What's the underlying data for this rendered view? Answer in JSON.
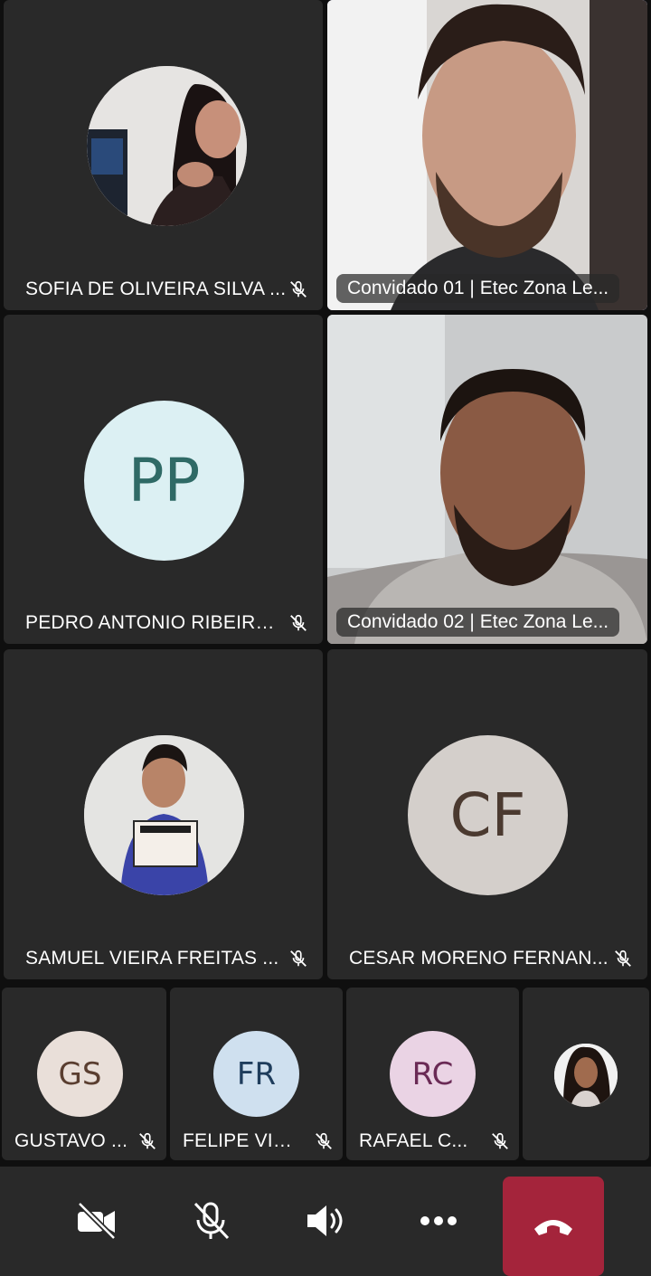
{
  "participants": {
    "p1": {
      "name": "SOFIA DE OLIVEIRA SILVA ...",
      "muted": true,
      "avatar_type": "photo"
    },
    "p2": {
      "name": "Convidado 01 | Etec Zona Le...",
      "active_speaker": true,
      "video": true
    },
    "p3": {
      "name": "PEDRO ANTONIO RIBEIRO ...",
      "initials": "PP",
      "muted": true,
      "avatar_bg": "#dcf0f3",
      "avatar_fg": "#2f6a66"
    },
    "p4": {
      "name": "Convidado 02 | Etec Zona Le...",
      "video": true
    },
    "p5": {
      "name": "SAMUEL VIEIRA FREITAS ...",
      "muted": true,
      "avatar_type": "photo"
    },
    "p6": {
      "name": "CESAR MORENO FERNAN...",
      "initials": "CF",
      "muted": true,
      "avatar_bg": "#d4cfcb",
      "avatar_fg": "#4b3a30"
    },
    "p7": {
      "name": "GUSTAVO ...",
      "initials": "GS",
      "muted": true,
      "avatar_bg": "#e9dfd9",
      "avatar_fg": "#5a3e30"
    },
    "p8": {
      "name": "FELIPE VIV...",
      "initials": "FR",
      "muted": true,
      "avatar_bg": "#cfe0ef",
      "avatar_fg": "#1f3d5c"
    },
    "p9": {
      "name": "RAFAEL C...",
      "initials": "RC",
      "muted": true,
      "avatar_bg": "#ead3e4",
      "avatar_fg": "#6a2a55"
    },
    "p10": {
      "avatar_type": "photo"
    }
  },
  "controls": {
    "camera": "camera-off-icon",
    "mic": "mic-off-icon",
    "speaker": "speaker-icon",
    "more": "more-icon",
    "hangup": "hang-up-icon",
    "hangup_color": "#a4243b",
    "active_speaker_color": "#7f85f5"
  }
}
